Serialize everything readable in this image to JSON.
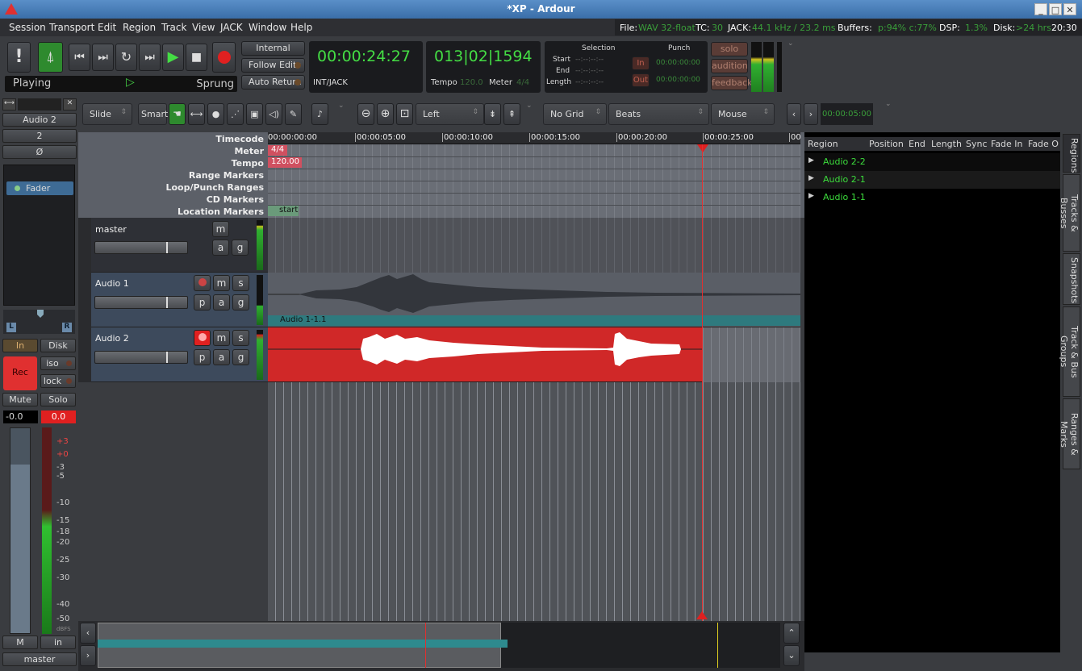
{
  "window": {
    "title": "*XP - Ardour"
  },
  "menu": [
    "Session",
    "Transport",
    "Edit",
    "Region",
    "Track",
    "View",
    "JACK",
    "Window",
    "Help"
  ],
  "status": {
    "file_label": "File:",
    "file_val": "WAV 32-float",
    "tc_label": "TC:",
    "tc_val": "30",
    "jack_label": "JACK:",
    "jack_val": "44.1 kHz / 23.2 ms",
    "buffers_label": "Buffers:",
    "buffers_val": "p:94% c:77%",
    "dsp_label": "DSP:",
    "dsp_val": "1.3%",
    "disk_label": "Disk:",
    "disk_val": ">24 hrs",
    "time": "20:30"
  },
  "transport": {
    "state": "Playing",
    "mode": "Sprung",
    "internal": "Internal",
    "follow_edits": "Follow Edits",
    "auto_return": "Auto Return"
  },
  "clocks": {
    "primary": "00:00:24:27",
    "primary_sub": "INT/JACK",
    "secondary": "013|02|1594",
    "tempo_label": "Tempo",
    "tempo_val": "120.0",
    "meter_label": "Meter",
    "meter_val": "4/4"
  },
  "selection": {
    "title": "Selection",
    "start": "Start",
    "end": "End",
    "length": "Length",
    "blank": "--:--:--:--",
    "punch": "Punch",
    "in": "In",
    "out": "Out",
    "punch_val": "00:00:00:00"
  },
  "mon": {
    "solo": "solo",
    "audition": "audition",
    "feedback": "feedback"
  },
  "editor": {
    "edit_mode": "Slide",
    "tool": "Smart",
    "zoom_focus": "Left",
    "grid": "No Grid",
    "grid_units": "Beats",
    "edit_point": "Mouse",
    "nudge": "00:00:05:00"
  },
  "rulers": {
    "labels": [
      "Timecode",
      "Meter",
      "Tempo",
      "Range Markers",
      "Loop/Punch Ranges",
      "CD Markers",
      "Location Markers"
    ],
    "timecode": [
      "00:00:00:00",
      "00:00:05:00",
      "00:00:10:00",
      "00:00:15:00",
      "00:00:20:00",
      "00:00:25:00",
      "00"
    ],
    "meter": "4/4",
    "tempo": "120.00",
    "marker": "start"
  },
  "tracks": [
    {
      "name": "master",
      "btn_m": "m",
      "btn_a": "a",
      "btn_g": "g"
    },
    {
      "name": "Audio 1",
      "region": "Audio 1-1.1",
      "btn_m": "m",
      "btn_s": "s",
      "btn_p": "p",
      "btn_a": "a",
      "btn_g": "g"
    },
    {
      "name": "Audio 2",
      "btn_m": "m",
      "btn_s": "s",
      "btn_p": "p",
      "btn_a": "a",
      "btn_g": "g"
    }
  ],
  "regions": {
    "headers": [
      "Region",
      "Position",
      "End",
      "Length",
      "Sync",
      "Fade In",
      "Fade Ou"
    ],
    "items": [
      "Audio 2-2",
      "Audio 2-1",
      "Audio 1-1"
    ]
  },
  "sidetabs": [
    "Regions",
    "Tracks & Busses",
    "Snapshots",
    "Track & Bus Groups",
    "Ranges & Marks"
  ],
  "strip": {
    "name": "Audio 2",
    "input": "2",
    "phase": "Ø",
    "plugin": "Fader",
    "in": "In",
    "disk": "Disk",
    "rec": "Rec",
    "iso": "iso",
    "lock": "lock",
    "mute": "Mute",
    "solo": "Solo",
    "gain": "-0.0",
    "peak": "0.0",
    "scale": [
      "+3",
      "+0",
      "-3",
      "-5",
      "-10",
      "-15",
      "-18",
      "-20",
      "-25",
      "-30",
      "-40",
      "-50"
    ],
    "dbfs": "dBFS",
    "m": "M",
    "in2": "in",
    "bus": "master",
    "l": "L",
    "r": "R"
  }
}
